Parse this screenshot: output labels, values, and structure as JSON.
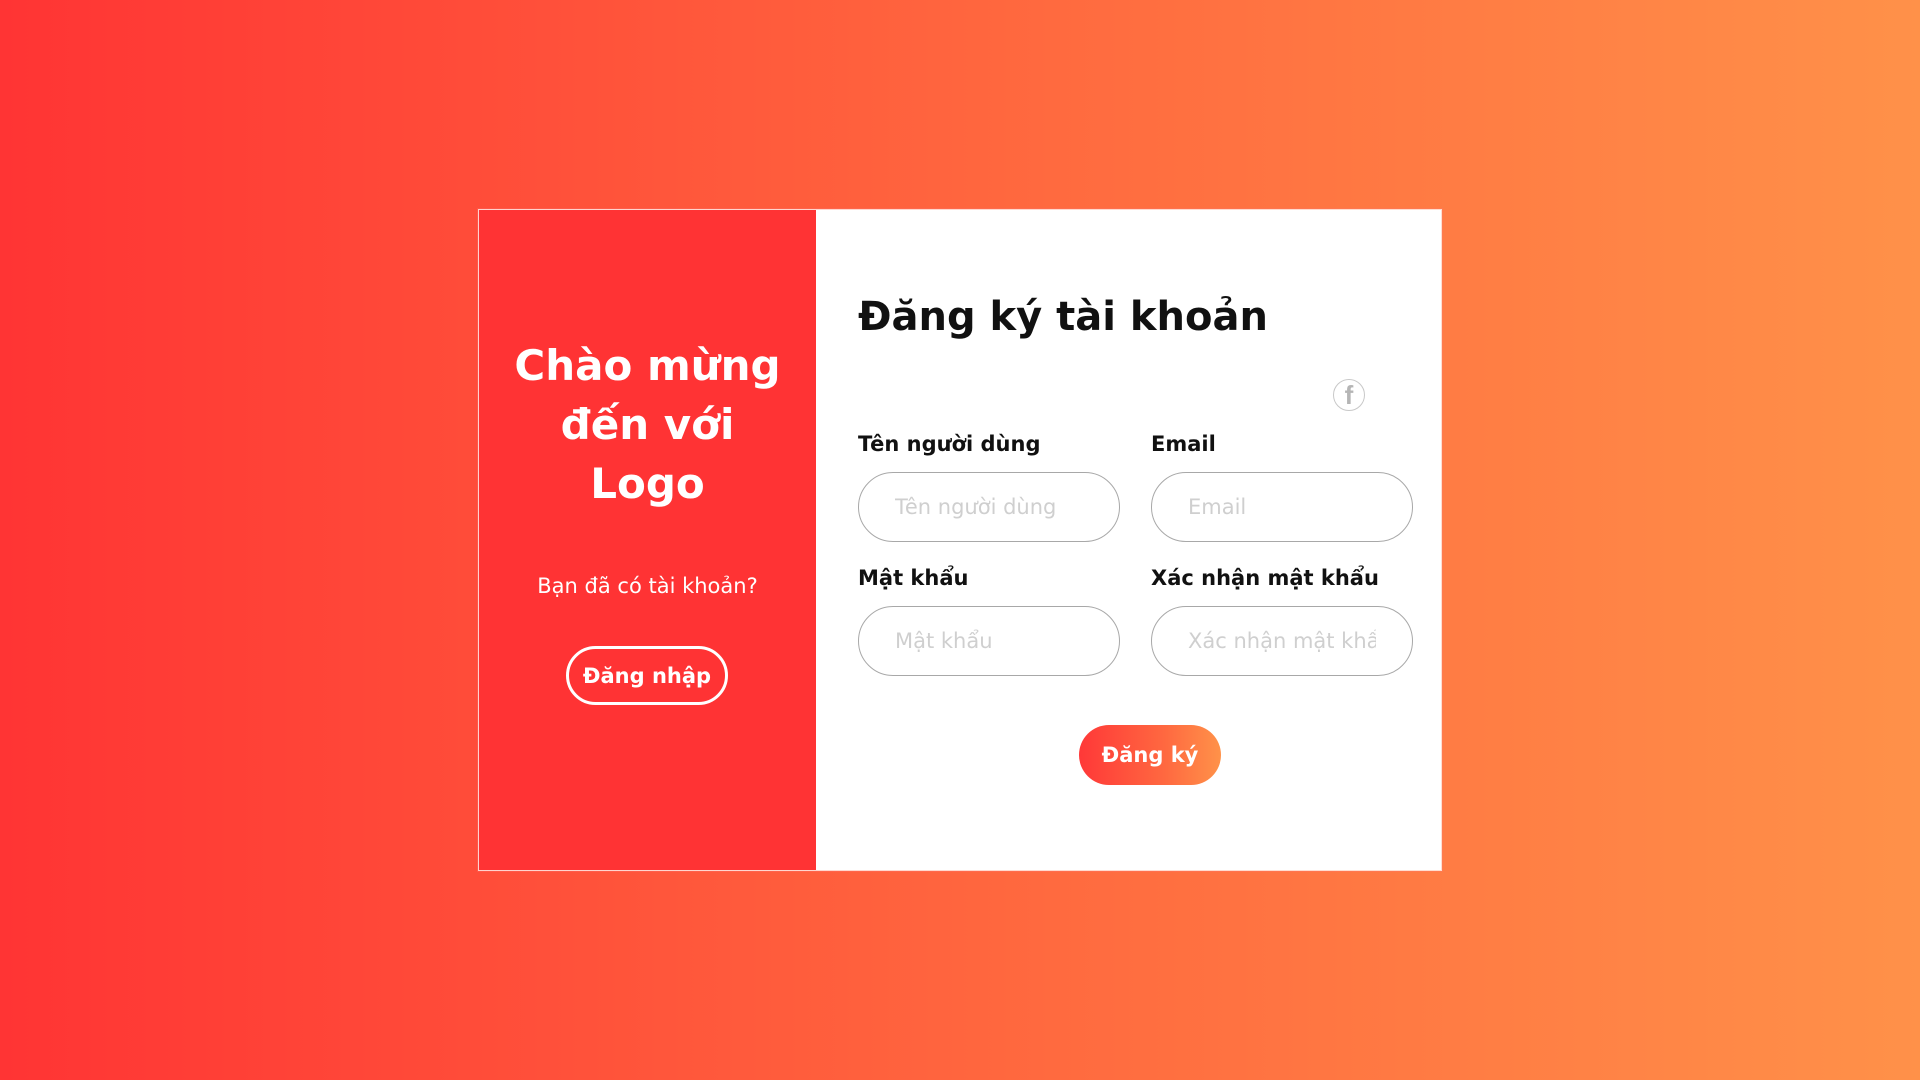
{
  "welcome_panel": {
    "heading": "Chào mừng\nđến với\nLogo",
    "prompt": "Bạn đã có tài khoản?",
    "login_label": "Đăng nhập"
  },
  "form": {
    "title": "Đăng ký tài khoản",
    "social_icon": "facebook-icon",
    "fields": [
      {
        "label": "Tên người dùng",
        "placeholder": "Tên người dùng",
        "value": ""
      },
      {
        "label": "Email",
        "placeholder": "Email",
        "value": ""
      },
      {
        "label": "Mật khẩu",
        "placeholder": "Mật khẩu",
        "value": ""
      },
      {
        "label": "Xác nhận mật khẩu",
        "placeholder": "Xác nhận mật khẩu",
        "value": ""
      }
    ],
    "submit_label": "Đăng ký"
  },
  "colors": {
    "accent": "#ff3334",
    "gradient_start": "#ff3434",
    "gradient_end": "#ff9149",
    "panel_background": "#ffffff"
  }
}
